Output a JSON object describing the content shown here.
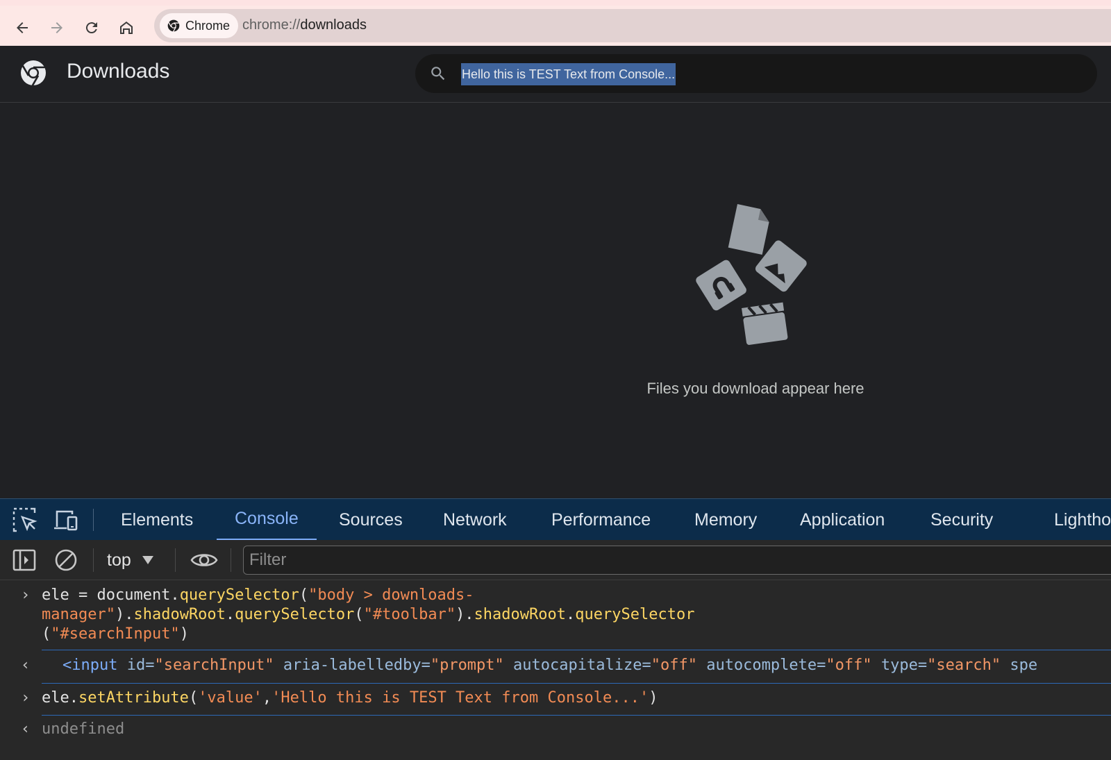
{
  "browser": {
    "chip_label": "Chrome",
    "url_scheme": "chrome://",
    "url_path": "downloads"
  },
  "downloads": {
    "title": "Downloads",
    "search_value": "Hello this is TEST Text from Console...",
    "empty_message": "Files you download appear here"
  },
  "devtools": {
    "tabs": [
      {
        "label": "Elements"
      },
      {
        "label": "Console"
      },
      {
        "label": "Sources"
      },
      {
        "label": "Network"
      },
      {
        "label": "Performance"
      },
      {
        "label": "Memory"
      },
      {
        "label": "Application"
      },
      {
        "label": "Security"
      },
      {
        "label": "Lighthouse"
      }
    ],
    "active_tab": "Console",
    "context": "top",
    "filter_placeholder": "Filter"
  },
  "console": {
    "cmd1": {
      "t1": "ele = document.",
      "t2": "querySelector",
      "t3": "(",
      "t4": "\"body > downloads-",
      "t5": "manager\"",
      "t6": ").",
      "t7": "shadowRoot",
      "t8": ".",
      "t9": "querySelector",
      "t10": "(",
      "t11": "\"#toolbar\"",
      "t12": ").",
      "t13": "shadowRoot",
      "t14": ".",
      "t15": "querySelector",
      "t16": "(",
      "t17": "\"#searchInput\"",
      "t18": ")"
    },
    "result1": {
      "open": "<input",
      "a1": " id=",
      "v1": "\"searchInput\"",
      "a2": " aria-labelledby=",
      "v2": "\"prompt\"",
      "a3": " autocapitalize=",
      "v3": "\"off\"",
      "a4": " autocomplete=",
      "v4": "\"off\"",
      "a5": " type=",
      "v5": "\"search\"",
      "a6": " spe"
    },
    "cmd2": {
      "t1": "ele.",
      "t2": "setAttribute",
      "t3": "(",
      "t4": "'value'",
      "t5": ",",
      "t6": "'Hello this is TEST Text from Console...'",
      "t7": ")"
    },
    "result2": "undefined"
  },
  "colors": {
    "accent": "#8ab4f8",
    "devtools_tabbar": "#0c2c4a",
    "page_bg": "#202124"
  }
}
